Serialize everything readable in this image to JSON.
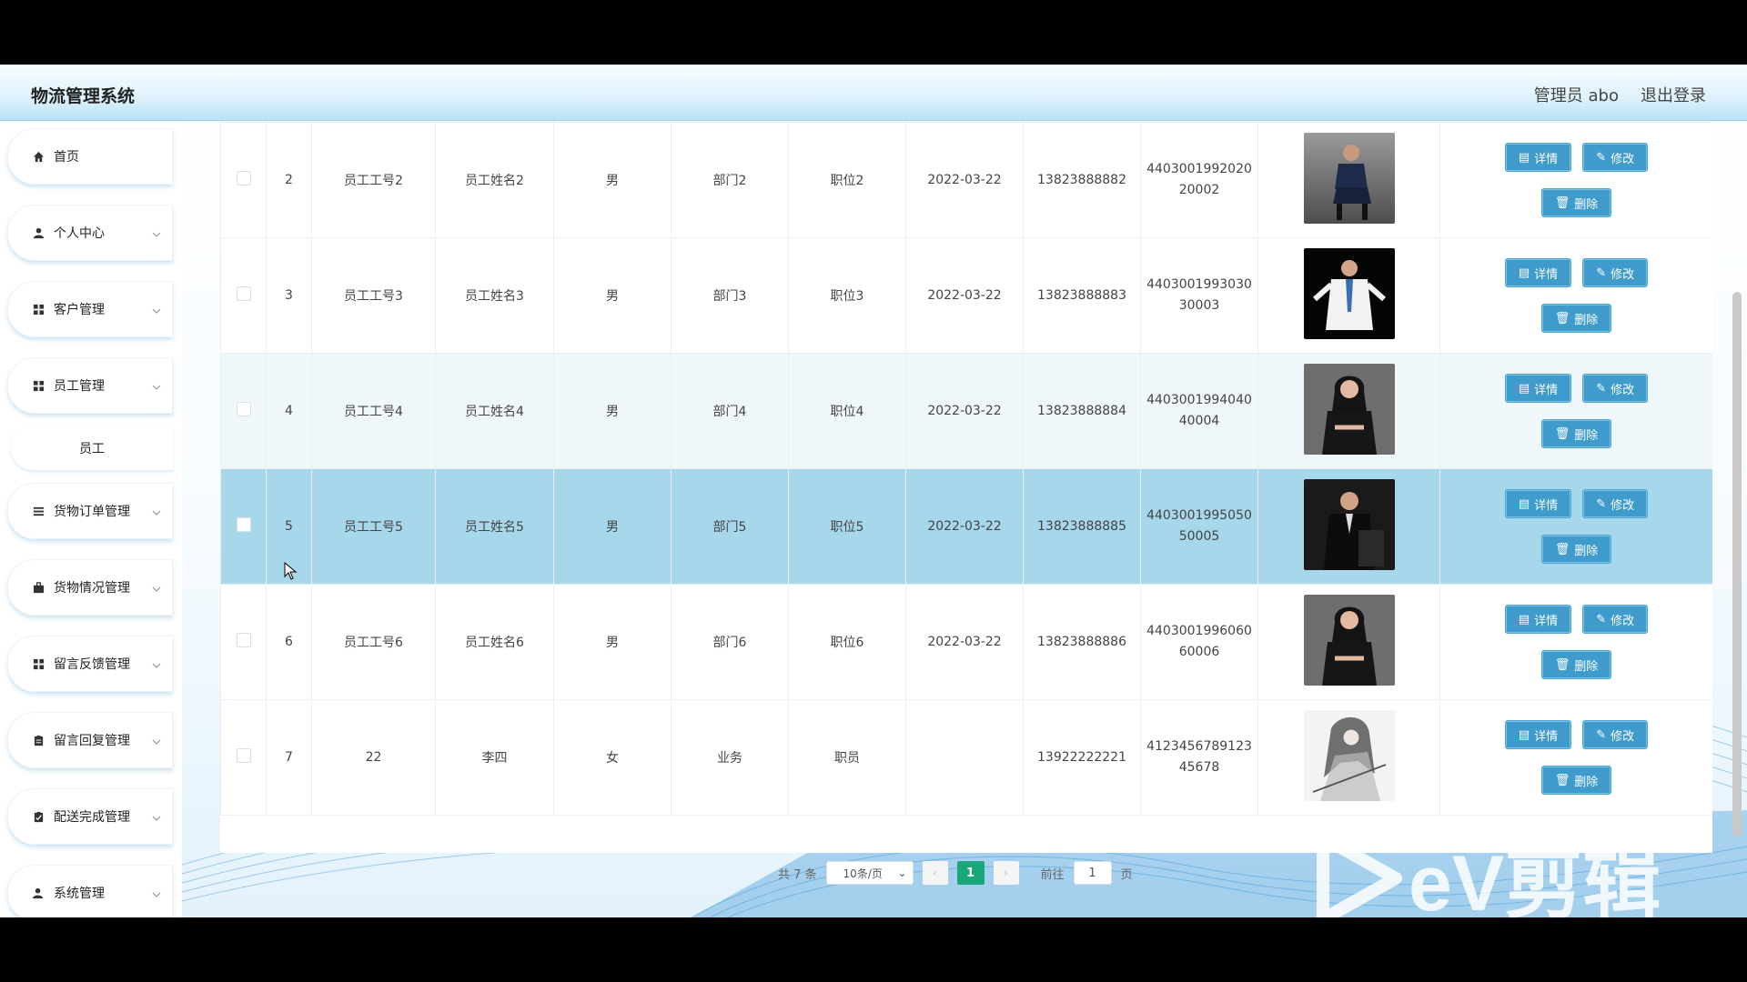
{
  "app": {
    "title": "物流管理系统"
  },
  "header": {
    "user": "管理员 abo",
    "logout": "退出登录"
  },
  "sidebar": {
    "items": [
      {
        "label": "首页",
        "icon": "home-icon"
      },
      {
        "label": "个人中心",
        "icon": "user-icon"
      },
      {
        "label": "客户管理",
        "icon": "grid-icon"
      },
      {
        "label": "员工管理",
        "icon": "grid-icon",
        "children": [
          "员工"
        ]
      },
      {
        "label": "货物订单管理",
        "icon": "list-icon"
      },
      {
        "label": "货物情况管理",
        "icon": "briefcase-icon"
      },
      {
        "label": "留言反馈管理",
        "icon": "grid-icon"
      },
      {
        "label": "留言回复管理",
        "icon": "clipboard-icon"
      },
      {
        "label": "配送完成管理",
        "icon": "clipboard-check-icon"
      },
      {
        "label": "系统管理",
        "icon": "user-settings-icon"
      }
    ]
  },
  "table": {
    "actions": {
      "detail": "详情",
      "edit": "修改",
      "delete": "删除"
    },
    "rows": [
      {
        "index": "2",
        "emp_no": "员工工号2",
        "name": "员工姓名2",
        "gender": "男",
        "dept": "部门2",
        "position": "职位2",
        "date": "2022-03-22",
        "phone": "13823888882",
        "id_line1": "4403001992020",
        "id_line2": "20002",
        "photo": "photo-man-suit-seated"
      },
      {
        "index": "3",
        "emp_no": "员工工号3",
        "name": "员工姓名3",
        "gender": "男",
        "dept": "部门3",
        "position": "职位3",
        "date": "2022-03-22",
        "phone": "13823888883",
        "id_line1": "4403001993030",
        "id_line2": "30003",
        "photo": "photo-man-white-coat"
      },
      {
        "index": "4",
        "emp_no": "员工工号4",
        "name": "员工姓名4",
        "gender": "男",
        "dept": "部门4",
        "position": "职位4",
        "date": "2022-03-22",
        "phone": "13823888884",
        "id_line1": "4403001994040",
        "id_line2": "40004",
        "photo": "photo-woman-black-dress"
      },
      {
        "index": "5",
        "emp_no": "员工工号5",
        "name": "员工姓名5",
        "gender": "男",
        "dept": "部门5",
        "position": "职位5",
        "date": "2022-03-22",
        "phone": "13823888885",
        "id_line1": "4403001995050",
        "id_line2": "50005",
        "photo": "photo-man-black-suit"
      },
      {
        "index": "6",
        "emp_no": "员工工号6",
        "name": "员工姓名6",
        "gender": "男",
        "dept": "部门6",
        "position": "职位6",
        "date": "2022-03-22",
        "phone": "13823888886",
        "id_line1": "4403001996060",
        "id_line2": "60006",
        "photo": "photo-woman-black-dress"
      },
      {
        "index": "7",
        "emp_no": "22",
        "name": "李四",
        "gender": "女",
        "dept": "业务",
        "position": "职员",
        "date": "",
        "phone": "13922222221",
        "id_line1": "4123456789123",
        "id_line2": "45678",
        "photo": "photo-anime-sketch"
      }
    ]
  },
  "pagination": {
    "total": "共 7 条",
    "page_size": "10条/页",
    "current_page": "1",
    "goto_prefix": "前往",
    "goto_value": "1",
    "goto_suffix": "页"
  },
  "watermark": {
    "text": "eV剪辑"
  },
  "colors": {
    "accent": "#3e9bcc",
    "selected_row": "#a6d7ea",
    "page_active": "#1aa87a"
  }
}
